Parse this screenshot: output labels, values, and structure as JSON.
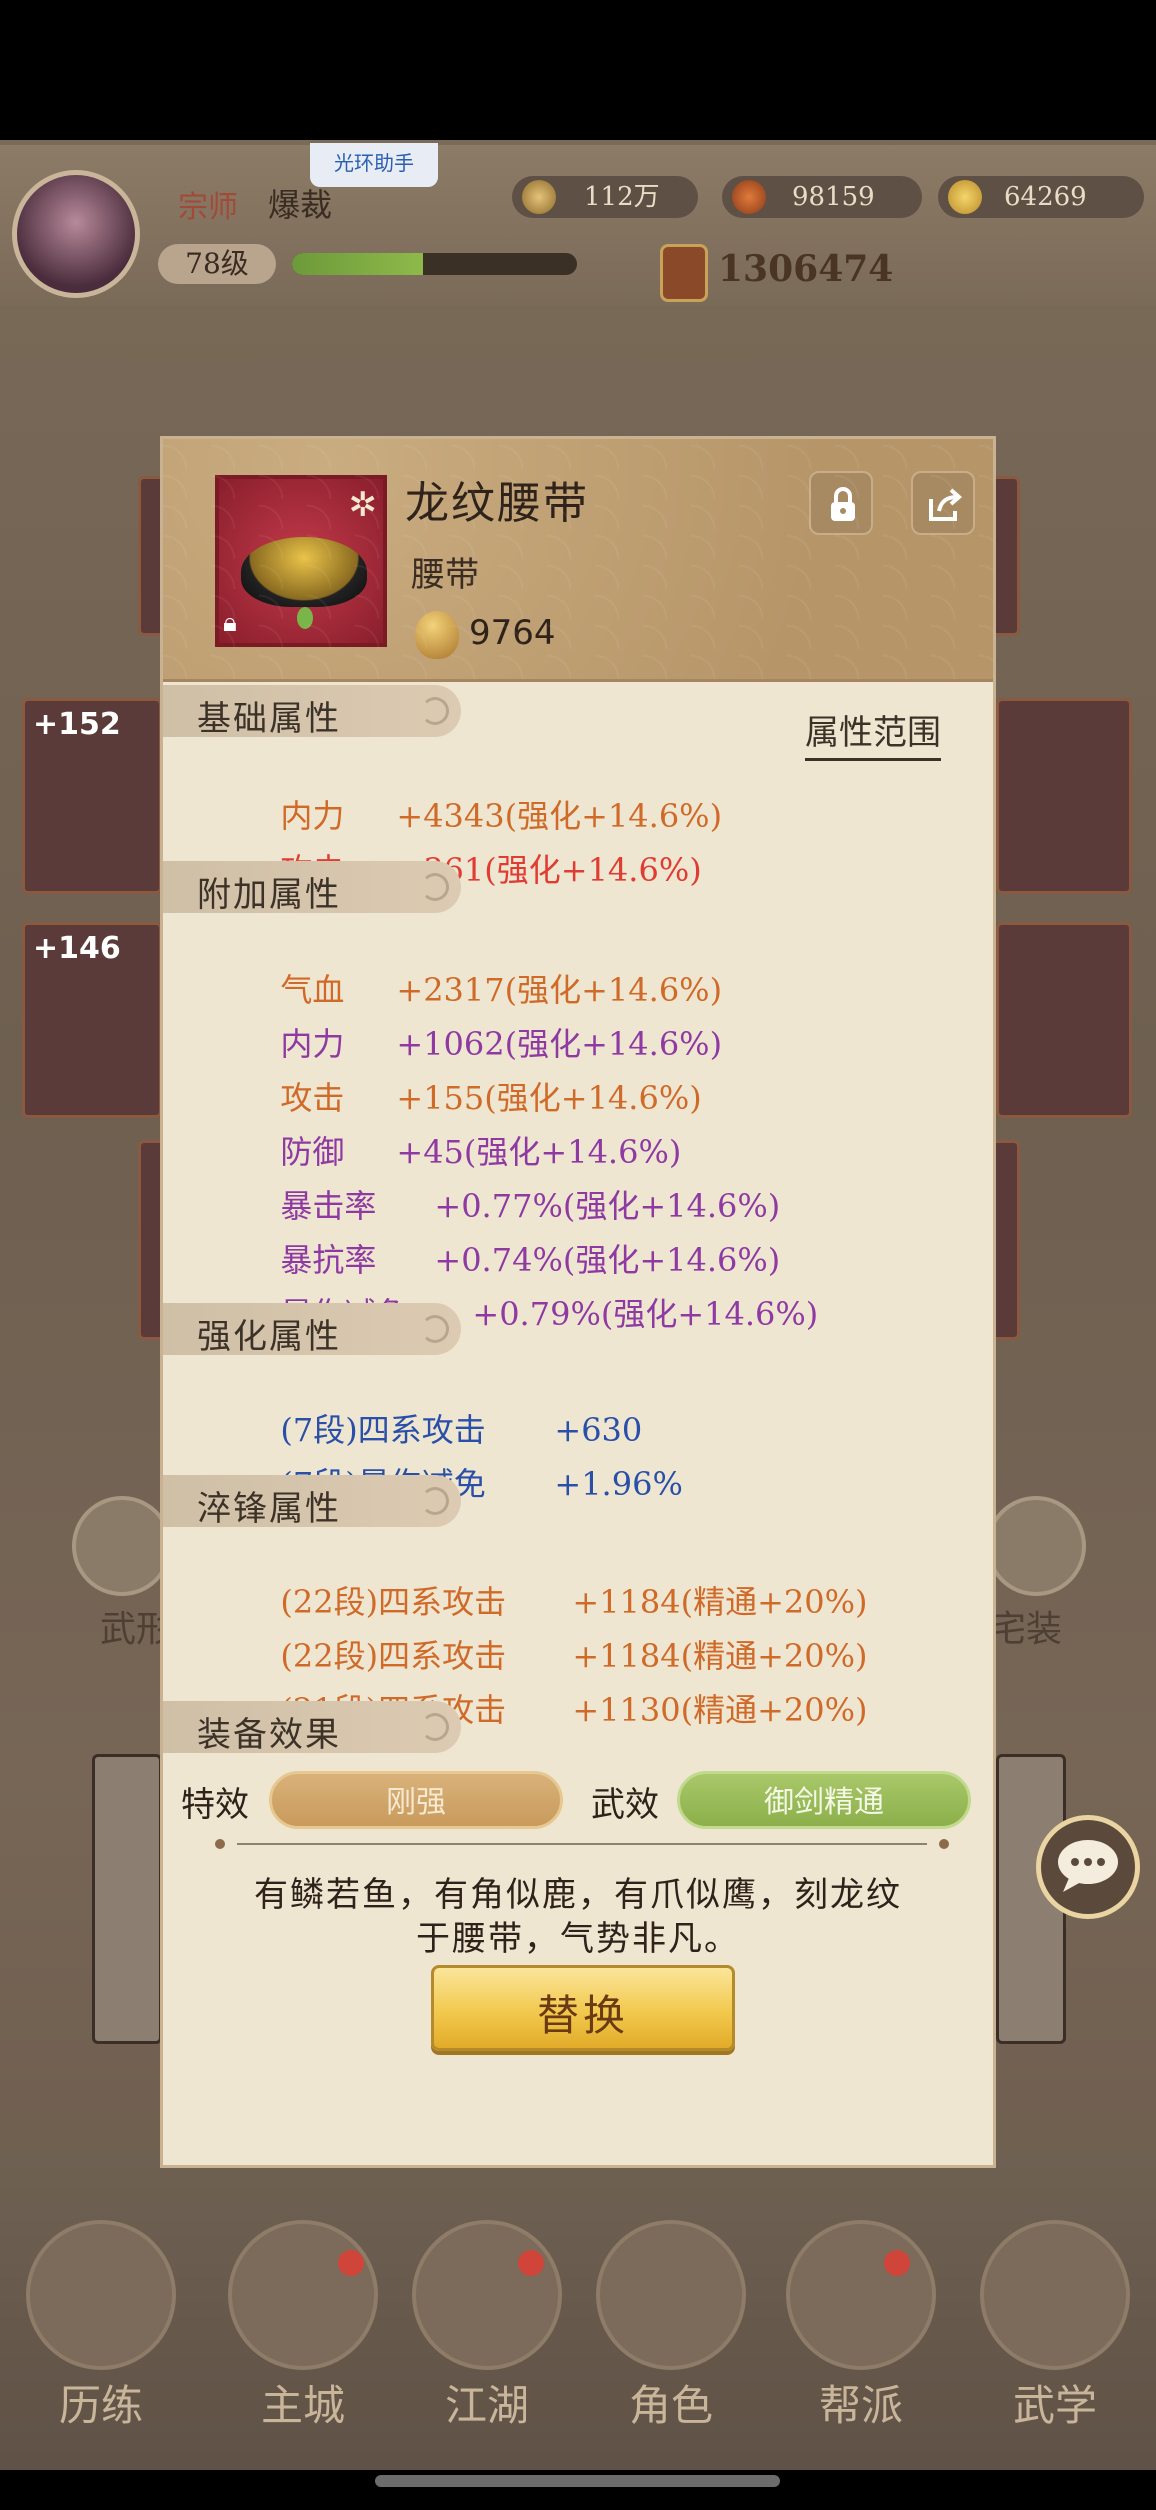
{
  "top_bar": {
    "helper_badge": "光环助手",
    "rank": "宗师",
    "player_name": "爆裁",
    "level": "78级",
    "exp_progress": 0.46,
    "coins": "112万",
    "resource_2": "98159",
    "ingots": "64269",
    "combat_power": "1306474"
  },
  "background": {
    "left_cards": [
      "+152",
      "+146"
    ],
    "left_button": "武形",
    "right_button": "宅装"
  },
  "item": {
    "name": "龙纹腰带",
    "type": "腰带",
    "value": "9764",
    "icon": "belt-icon"
  },
  "sections": {
    "base": "基础属性",
    "extra": "附加属性",
    "enhance": "强化属性",
    "temper": "淬锋属性",
    "effects": "装备效果",
    "range_link": "属性范围"
  },
  "base_attrs": [
    {
      "label": "内力",
      "value": "+4343(强化+14.6%)",
      "color": "#d06a28"
    },
    {
      "label": "攻击",
      "value": "+361(强化+14.6%)",
      "color": "#e03c32"
    }
  ],
  "extra_attrs": [
    {
      "label": "气血",
      "value": "+2317(强化+14.6%)",
      "color": "#d06a28"
    },
    {
      "label": "内力",
      "value": "+1062(强化+14.6%)",
      "color": "#8e3aa2"
    },
    {
      "label": "攻击",
      "value": "+155(强化+14.6%)",
      "color": "#d06a28"
    },
    {
      "label": "防御",
      "value": "+45(强化+14.6%)",
      "color": "#8e3aa2"
    },
    {
      "label": "暴击率",
      "value": "+0.77%(强化+14.6%)",
      "color": "#8e3aa2"
    },
    {
      "label": "暴抗率",
      "value": "+0.74%(强化+14.6%)",
      "color": "#8e3aa2"
    },
    {
      "label": "暴伤减免",
      "value": "+0.79%(强化+14.6%)",
      "color": "#8e3aa2"
    }
  ],
  "enhance_attrs": [
    {
      "label": "(7段)四系攻击",
      "value": "+630",
      "color": "#2a4fa8"
    },
    {
      "label": "(7段)暴伤减免",
      "value": "+1.96%",
      "color": "#2a4fa8"
    }
  ],
  "temper_attrs": [
    {
      "label": "(22段)四系攻击",
      "value": "+1184(精通+20%)",
      "color": "#d06a28"
    },
    {
      "label": "(22段)四系攻击",
      "value": "+1184(精通+20%)",
      "color": "#d06a28"
    },
    {
      "label": "(21段)四系攻击",
      "value": "+1130(精通+20%)",
      "color": "#d06a28"
    }
  ],
  "effects": {
    "special_label": "特效",
    "special_value": "刚强",
    "martial_label": "武效",
    "martial_value": "御剑精通"
  },
  "description_line1": "有鳞若鱼，有角似鹿，有爪似鹰，刻龙纹",
  "description_line2": "于腰带，气势非凡。",
  "replace_button": "替换",
  "bottom_nav": [
    "历练",
    "主城",
    "江湖",
    "角色",
    "帮派",
    "武学"
  ]
}
